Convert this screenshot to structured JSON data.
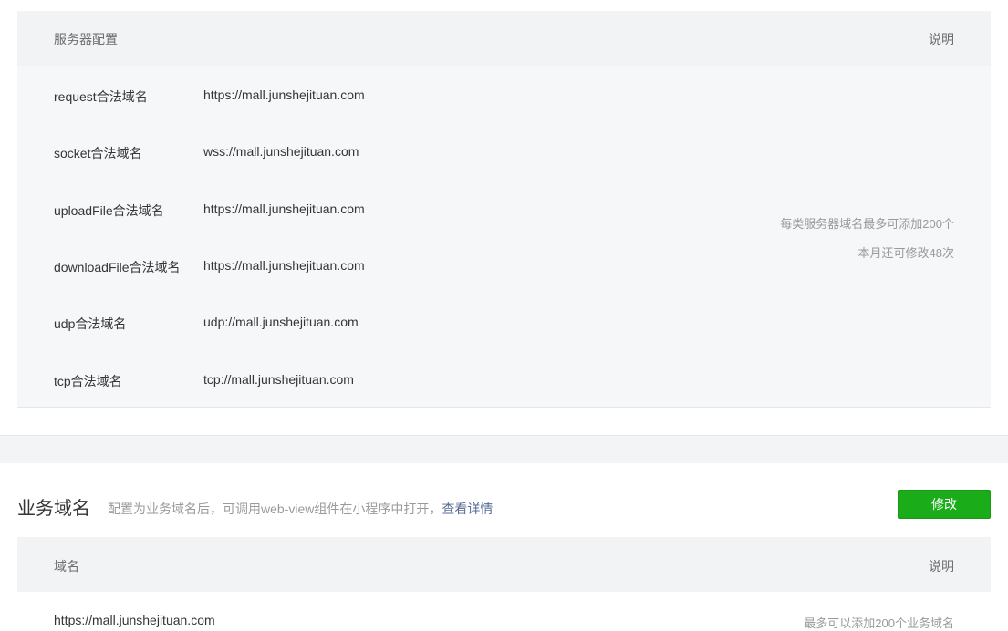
{
  "server_config": {
    "header_left": "服务器配置",
    "header_right": "说明",
    "rows": [
      {
        "label": "request合法域名",
        "value": "https://mall.junshejituan.com"
      },
      {
        "label": "socket合法域名",
        "value": "wss://mall.junshejituan.com"
      },
      {
        "label": "uploadFile合法域名",
        "value": "https://mall.junshejituan.com"
      },
      {
        "label": "downloadFile合法域名",
        "value": "https://mall.junshejituan.com"
      },
      {
        "label": "udp合法域名",
        "value": "udp://mall.junshejituan.com"
      },
      {
        "label": "tcp合法域名",
        "value": "tcp://mall.junshejituan.com"
      }
    ],
    "note_line1": "每类服务器域名最多可添加200个",
    "note_line2": "本月还可修改48次"
  },
  "business_domain": {
    "title": "业务域名",
    "description": "配置为业务域名后，可调用web-view组件在小程序中打开，",
    "details_link": "查看详情",
    "modify_button": "修改",
    "header_left": "域名",
    "header_right": "说明",
    "domain_value": "https://mall.junshejituan.com",
    "note": "最多可以添加200个业务域名"
  },
  "colors": {
    "primary_green": "#1aad19",
    "link_blue": "#576b95"
  }
}
